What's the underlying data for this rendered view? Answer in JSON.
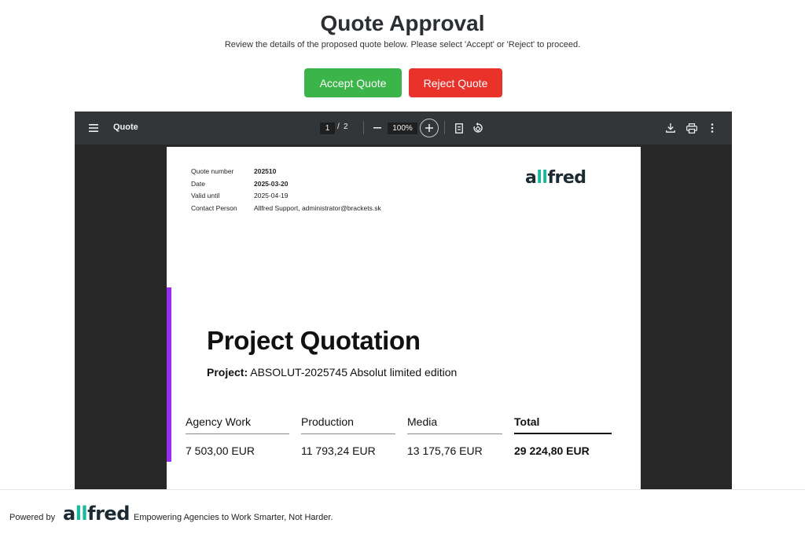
{
  "header": {
    "title": "Quote Approval",
    "subtitle": "Review the details of the proposed quote below. Please select 'Accept' or 'Reject' to proceed."
  },
  "actions": {
    "accept_label": "Accept Quote",
    "reject_label": "Reject Quote",
    "accept_color": "#3bb54a",
    "reject_color": "#e8322a"
  },
  "viewer": {
    "doc_title": "Quote",
    "current_page": "1",
    "page_separator": "/",
    "total_pages": "2",
    "zoom": "100%",
    "icons": [
      "menu-icon",
      "zoom-out-icon",
      "zoom-in-icon",
      "fit-page-icon",
      "rotate-icon",
      "download-icon",
      "print-icon",
      "more-vert-icon"
    ]
  },
  "document": {
    "meta": [
      {
        "label": "Quote number",
        "value": "202510",
        "bold": true
      },
      {
        "label": "Date",
        "value": "2025-03-20",
        "bold": true
      },
      {
        "label": "Valid until",
        "value": "2025-04-19",
        "bold": false
      },
      {
        "label": "Contact Person",
        "value": "Allfred Support, administrator@brackets.sk",
        "bold": false
      }
    ],
    "logo": {
      "prefix": "a",
      "highlight": "ll",
      "suffix": "fred"
    },
    "accent_color": "#9a2df0",
    "heading": "Project Quotation",
    "project_label": "Project:",
    "project_value": "ABSOLUT-2025745 Absolut limited edition",
    "summary": [
      {
        "label": "Agency Work",
        "value": "7 503,00 EUR"
      },
      {
        "label": "Production",
        "value": "11 793,24 EUR"
      },
      {
        "label": "Media",
        "value": "13 175,76 EUR"
      },
      {
        "label": "Total",
        "value": "29 224,80 EUR"
      }
    ]
  },
  "footer": {
    "powered_by": "Powered by",
    "logo": {
      "prefix": "a",
      "highlight": "ll",
      "suffix": "fred"
    },
    "tagline": "Empowering Agencies to Work Smarter, Not Harder."
  }
}
